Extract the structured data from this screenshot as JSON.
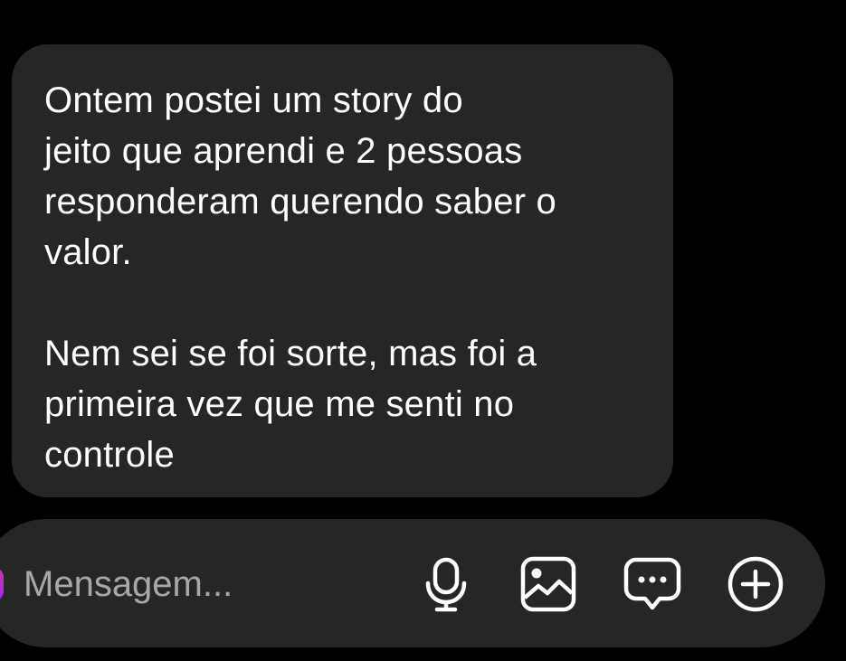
{
  "message": {
    "text": "Ontem postei um story do\njeito que aprendi e 2 pessoas\nresponderam querendo saber o\nvalor.\n\nNem sei se foi sorte, mas foi a\nprimeira vez que me senti no\ncontrole"
  },
  "composer": {
    "placeholder": "Mensagem...",
    "icons": [
      "microphone-icon",
      "gallery-icon",
      "sticker-chat-icon",
      "add-circle-icon"
    ]
  },
  "colors": {
    "background": "#000000",
    "bubble": "#262626",
    "text": "#ffffff",
    "placeholder": "#a8a8a8",
    "avatar_accent": "#c837ab"
  }
}
